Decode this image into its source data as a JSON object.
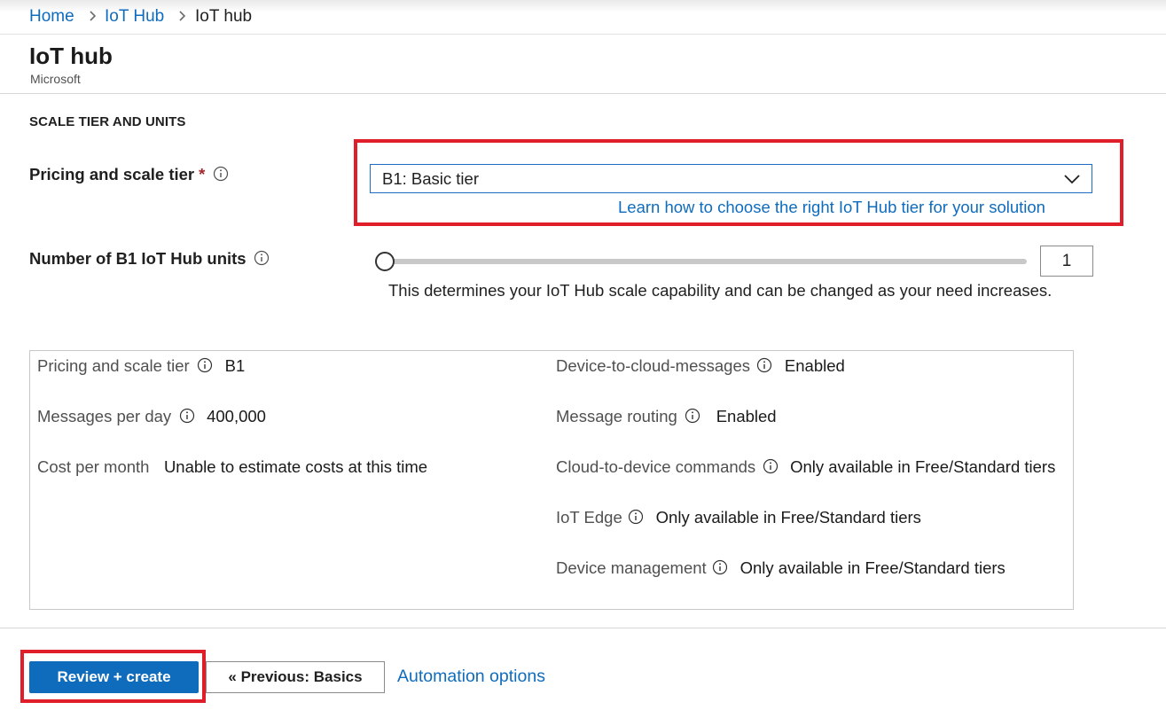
{
  "breadcrumb": {
    "items": [
      {
        "label": "Home",
        "link": true
      },
      {
        "label": "IoT Hub",
        "link": true
      },
      {
        "label": "IoT hub",
        "link": false
      }
    ]
  },
  "page": {
    "title": "IoT hub",
    "subtitle": "Microsoft"
  },
  "section": {
    "title": "SCALE TIER AND UNITS"
  },
  "pricing_field": {
    "label": "Pricing and scale tier",
    "required_marker": "*",
    "selected_value": "B1: Basic tier",
    "learn_link": "Learn how to choose the right IoT Hub tier for your solution"
  },
  "units_field": {
    "label": "Number of B1 IoT Hub units",
    "value": "1",
    "slider_position": 0,
    "help_text": "This determines your IoT Hub scale capability and can be changed as your need increases."
  },
  "summary": {
    "left": [
      {
        "key": "Pricing and scale tier",
        "value": "B1",
        "info": true
      },
      {
        "key": "Messages per day",
        "value": "400,000",
        "info": true
      },
      {
        "key": "Cost per month",
        "value": "Unable to estimate costs at this time",
        "info": false
      }
    ],
    "right": [
      {
        "key": "Device-to-cloud-messages",
        "value": "Enabled",
        "info": true
      },
      {
        "key": "Message routing",
        "value": "Enabled",
        "info": true
      },
      {
        "key": "Cloud-to-device commands",
        "value": "Only available in Free/Standard tiers",
        "info": true
      },
      {
        "key": "IoT Edge",
        "value": "Only available in Free/Standard tiers",
        "info": true
      },
      {
        "key": "Device management",
        "value": "Only available in Free/Standard tiers",
        "info": true
      }
    ]
  },
  "footer": {
    "review_create": "Review + create",
    "previous": "« Previous: Basics",
    "automation": "Automation options"
  },
  "colors": {
    "accent": "#0f6cbd",
    "highlight": "#e01e2a",
    "required": "#a4262c"
  }
}
